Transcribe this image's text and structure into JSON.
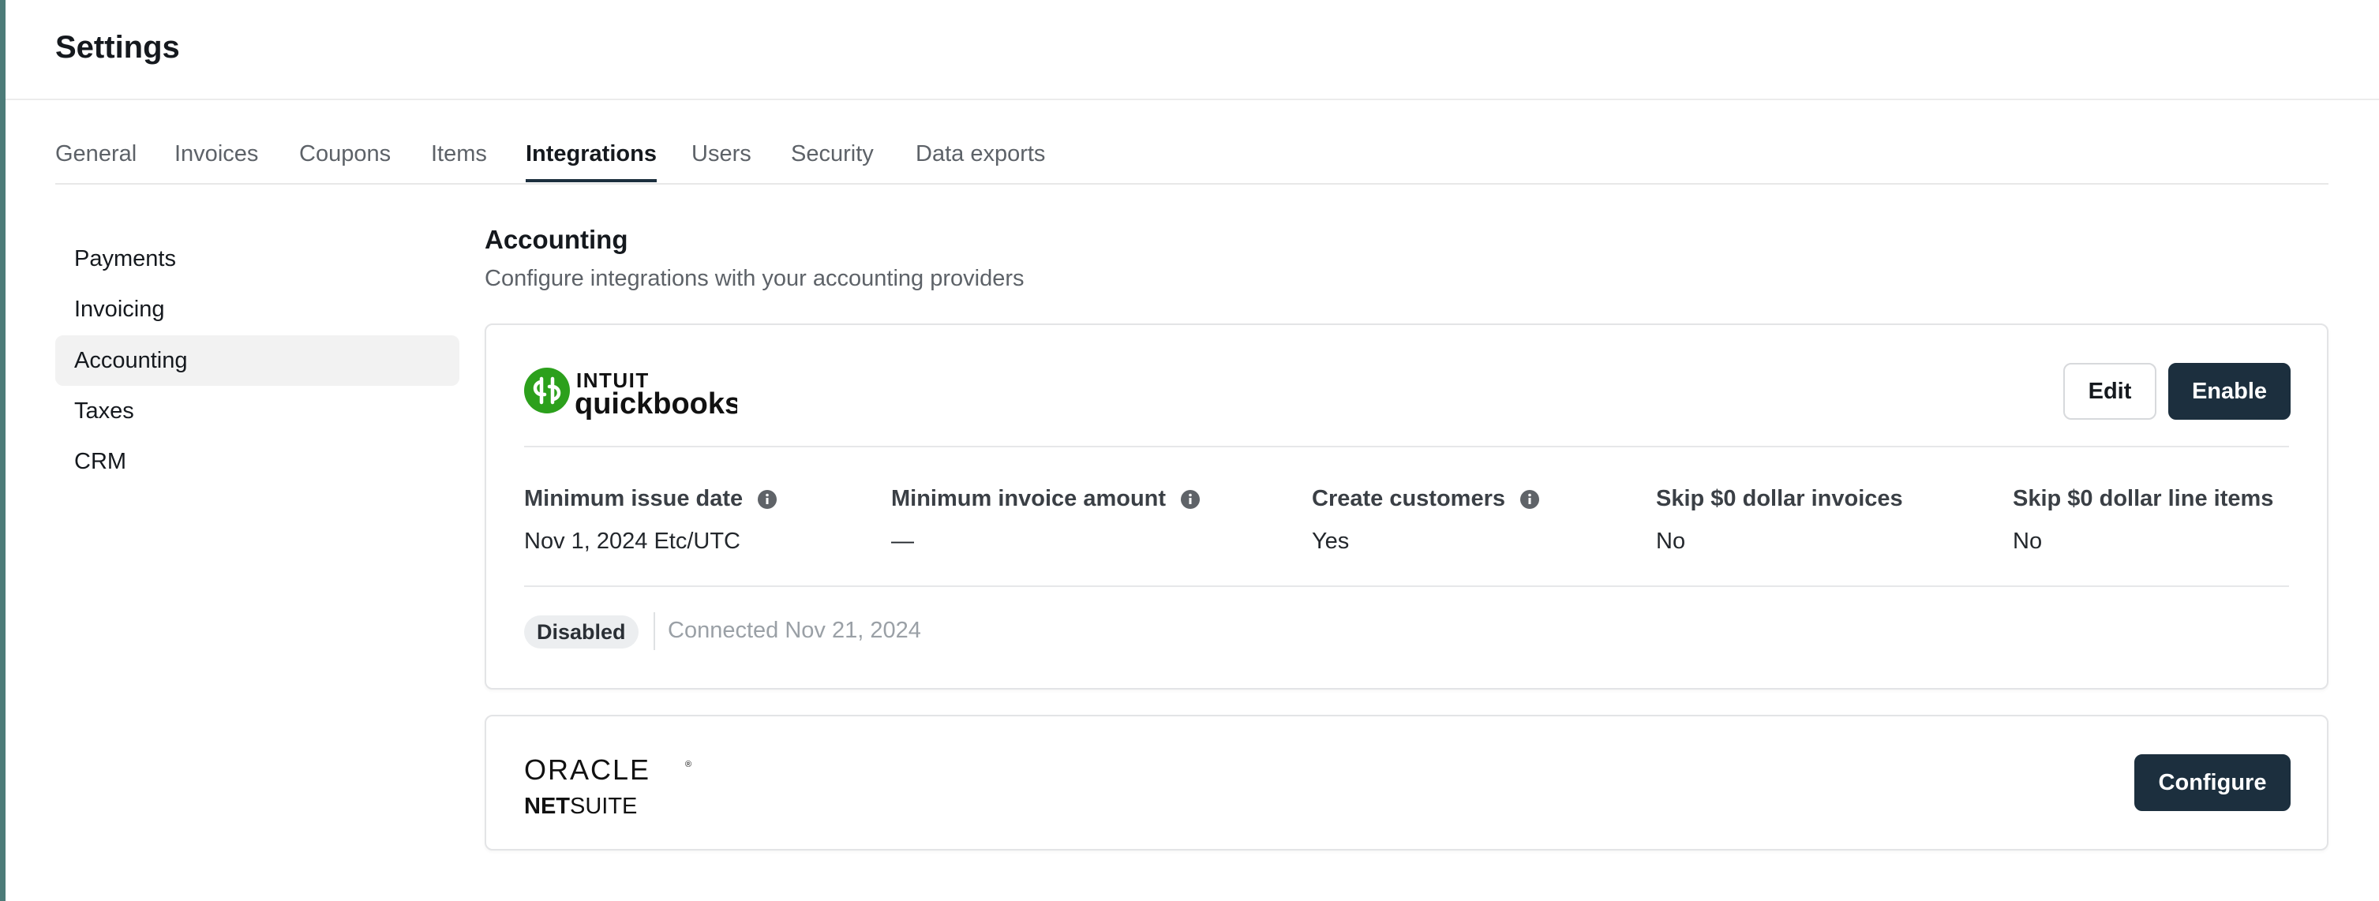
{
  "header": {
    "title": "Settings"
  },
  "tabs": [
    {
      "label": "General",
      "active": false
    },
    {
      "label": "Invoices",
      "active": false
    },
    {
      "label": "Coupons",
      "active": false
    },
    {
      "label": "Items",
      "active": false
    },
    {
      "label": "Integrations",
      "active": true
    },
    {
      "label": "Users",
      "active": false
    },
    {
      "label": "Security",
      "active": false
    },
    {
      "label": "Data exports",
      "active": false
    }
  ],
  "sidebar": {
    "items": [
      {
        "label": "Payments",
        "active": false
      },
      {
        "label": "Invoicing",
        "active": false
      },
      {
        "label": "Accounting",
        "active": true
      },
      {
        "label": "Taxes",
        "active": false
      },
      {
        "label": "CRM",
        "active": false
      }
    ]
  },
  "section": {
    "title": "Accounting",
    "subtitle": "Configure integrations with your accounting providers"
  },
  "quickbooks": {
    "logo_top": "INTUIT",
    "logo_bottom": "quickbooks",
    "logo_icon": "qb",
    "edit_label": "Edit",
    "enable_label": "Enable",
    "fields": [
      {
        "label": "Minimum issue date",
        "value": "Nov 1, 2024 Etc/UTC",
        "info": true
      },
      {
        "label": "Minimum invoice amount",
        "value": "—",
        "info": true
      },
      {
        "label": "Create customers",
        "value": "Yes",
        "info": true
      },
      {
        "label": "Skip $0 dollar invoices",
        "value": "No",
        "info": false
      },
      {
        "label": "Skip $0 dollar line items",
        "value": "No",
        "info": false
      }
    ],
    "status": "Disabled",
    "connected": "Connected Nov 21, 2024"
  },
  "netsuite": {
    "logo_top": "ORACLE",
    "logo_registered": "®",
    "logo_bottom_bold": "NET",
    "logo_bottom_regular": "SUITE",
    "configure_label": "Configure"
  },
  "colors": {
    "accent_bar": "#4c7b78",
    "primary_button": "#1c2f3e",
    "quickbooks_green": "#2ca01c"
  },
  "icons": [
    "info-icon",
    "quickbooks-logo",
    "oracle-netsuite-logo"
  ]
}
